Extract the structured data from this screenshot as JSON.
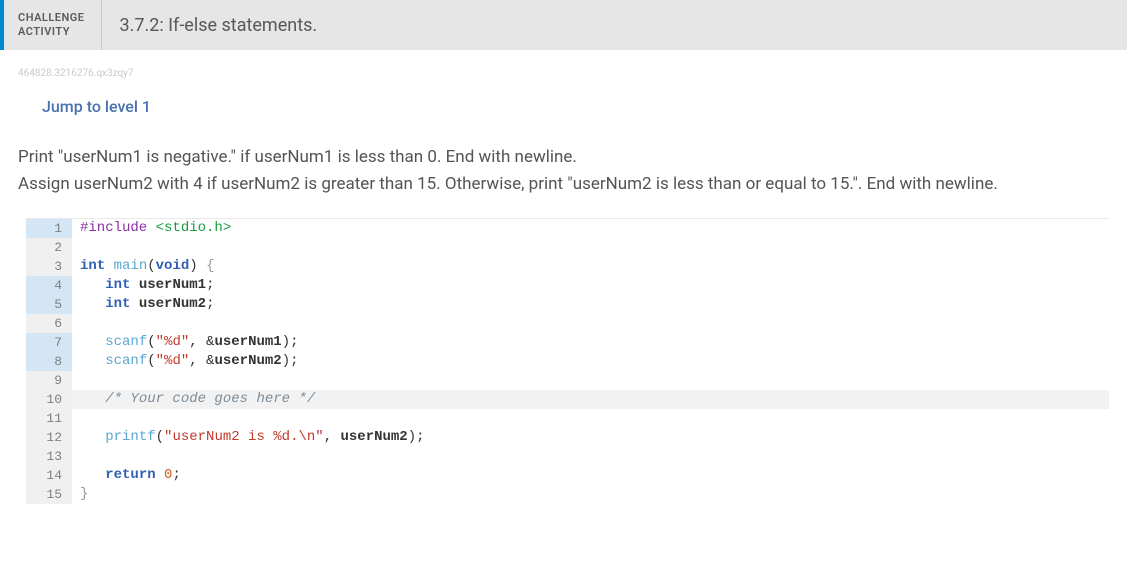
{
  "header": {
    "activity_label_line1": "CHALLENGE",
    "activity_label_line2": "ACTIVITY",
    "title": "3.7.2: If-else statements."
  },
  "hash": "464828.3216276.qx3zqy7",
  "jump_link": "Jump to level 1",
  "instructions_line1": "Print \"userNum1 is negative.\" if userNum1 is less than 0. End with newline.",
  "instructions_line2": "Assign userNum2 with 4 if userNum2 is greater than 15. Otherwise, print \"userNum2 is less than or equal to 15.\". End with newline.",
  "code": {
    "lines": [
      {
        "n": "1",
        "hl": true,
        "tokens": [
          {
            "t": "#include ",
            "c": "tok-preproc"
          },
          {
            "t": "<stdio.h>",
            "c": "tok-include"
          }
        ]
      },
      {
        "n": "2",
        "hl": false,
        "tokens": []
      },
      {
        "n": "3",
        "hl": false,
        "tokens": [
          {
            "t": "int",
            "c": "tok-type"
          },
          {
            "t": " ",
            "c": "tok-plain"
          },
          {
            "t": "main",
            "c": "tok-func"
          },
          {
            "t": "(",
            "c": "tok-plain"
          },
          {
            "t": "void",
            "c": "tok-type"
          },
          {
            "t": ") ",
            "c": "tok-plain"
          },
          {
            "t": "{",
            "c": "tok-brace"
          }
        ]
      },
      {
        "n": "4",
        "hl": true,
        "tokens": [
          {
            "t": "   ",
            "c": "tok-plain"
          },
          {
            "t": "int",
            "c": "tok-type"
          },
          {
            "t": " ",
            "c": "tok-plain"
          },
          {
            "t": "userNum1",
            "c": "tok-var"
          },
          {
            "t": ";",
            "c": "tok-plain"
          }
        ]
      },
      {
        "n": "5",
        "hl": true,
        "tokens": [
          {
            "t": "   ",
            "c": "tok-plain"
          },
          {
            "t": "int",
            "c": "tok-type"
          },
          {
            "t": " ",
            "c": "tok-plain"
          },
          {
            "t": "userNum2",
            "c": "tok-var"
          },
          {
            "t": ";",
            "c": "tok-plain"
          }
        ]
      },
      {
        "n": "6",
        "hl": false,
        "tokens": []
      },
      {
        "n": "7",
        "hl": true,
        "tokens": [
          {
            "t": "   ",
            "c": "tok-plain"
          },
          {
            "t": "scanf",
            "c": "tok-func"
          },
          {
            "t": "(",
            "c": "tok-plain"
          },
          {
            "t": "\"%d\"",
            "c": "tok-string"
          },
          {
            "t": ", &",
            "c": "tok-plain"
          },
          {
            "t": "userNum1",
            "c": "tok-var"
          },
          {
            "t": ");",
            "c": "tok-plain"
          }
        ]
      },
      {
        "n": "8",
        "hl": true,
        "tokens": [
          {
            "t": "   ",
            "c": "tok-plain"
          },
          {
            "t": "scanf",
            "c": "tok-func"
          },
          {
            "t": "(",
            "c": "tok-plain"
          },
          {
            "t": "\"%d\"",
            "c": "tok-string"
          },
          {
            "t": ", &",
            "c": "tok-plain"
          },
          {
            "t": "userNum2",
            "c": "tok-var"
          },
          {
            "t": ");",
            "c": "tok-plain"
          }
        ]
      },
      {
        "n": "9",
        "hl": false,
        "tokens": []
      },
      {
        "n": "10",
        "hl": false,
        "current": true,
        "tokens": [
          {
            "t": "   ",
            "c": "tok-plain"
          },
          {
            "t": "/* Your code goes here */",
            "c": "tok-comment"
          }
        ]
      },
      {
        "n": "11",
        "hl": false,
        "tokens": []
      },
      {
        "n": "12",
        "hl": false,
        "tokens": [
          {
            "t": "   ",
            "c": "tok-plain"
          },
          {
            "t": "printf",
            "c": "tok-func"
          },
          {
            "t": "(",
            "c": "tok-plain"
          },
          {
            "t": "\"userNum2 is %d.\\n\"",
            "c": "tok-string"
          },
          {
            "t": ", ",
            "c": "tok-plain"
          },
          {
            "t": "userNum2",
            "c": "tok-var"
          },
          {
            "t": ");",
            "c": "tok-plain"
          }
        ]
      },
      {
        "n": "13",
        "hl": false,
        "tokens": []
      },
      {
        "n": "14",
        "hl": false,
        "tokens": [
          {
            "t": "   ",
            "c": "tok-plain"
          },
          {
            "t": "return",
            "c": "tok-keyword"
          },
          {
            "t": " ",
            "c": "tok-plain"
          },
          {
            "t": "0",
            "c": "tok-number"
          },
          {
            "t": ";",
            "c": "tok-plain"
          }
        ]
      },
      {
        "n": "15",
        "hl": false,
        "tokens": [
          {
            "t": "}",
            "c": "tok-brace"
          }
        ]
      }
    ]
  }
}
